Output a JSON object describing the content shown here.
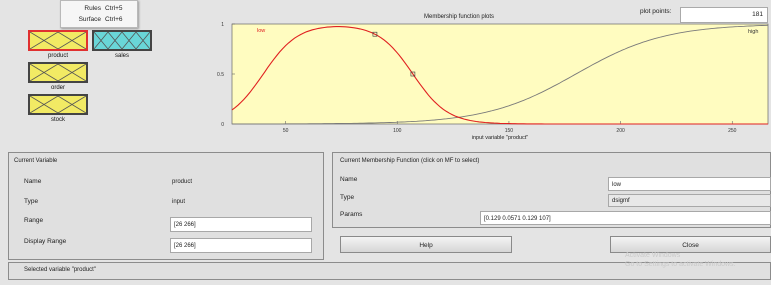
{
  "menu": {
    "items": [
      {
        "label": "Rules",
        "shortcut": "Ctrl+5"
      },
      {
        "label": "Surface",
        "shortcut": "Ctrl+6"
      }
    ]
  },
  "variables": {
    "inputs": [
      "product",
      "order",
      "stock"
    ],
    "outputs": [
      "sales"
    ],
    "selected": "product"
  },
  "plot": {
    "title": "Membership function plots",
    "points_label": "plot points:",
    "points_value": "181",
    "x_axis_label": "input variable \"product\"",
    "xlim": [
      26,
      266
    ],
    "ylim": [
      0,
      1
    ],
    "x_ticks": [
      "50",
      "100",
      "150",
      "200",
      "250"
    ],
    "y_ticks": [
      "0",
      "0.5",
      "1"
    ],
    "mf_labels": [
      "low",
      "high"
    ],
    "selected_color": "#e02020",
    "other_color": "#7a7a7a",
    "background_color": "#fffcc0"
  },
  "current_variable": {
    "title": "Current Variable",
    "rows": [
      {
        "label": "Name",
        "value": "product"
      },
      {
        "label": "Type",
        "value": "input"
      },
      {
        "label": "Range",
        "value": "[26 266]"
      },
      {
        "label": "Display Range",
        "value": "[26 266]"
      }
    ]
  },
  "current_mf": {
    "title": "Current Membership Function (click on MF to select)",
    "name_label": "Name",
    "name_value": "low",
    "type_label": "Type",
    "type_value": "dsigmf",
    "params_label": "Params",
    "params_value": "[0.129 0.0571 0.129 107]"
  },
  "buttons": {
    "help": "Help",
    "close": "Close"
  },
  "status": "Selected variable \"product\"",
  "watermark": [
    "Activate Windows",
    "Go to Settings to activate Windows."
  ]
}
